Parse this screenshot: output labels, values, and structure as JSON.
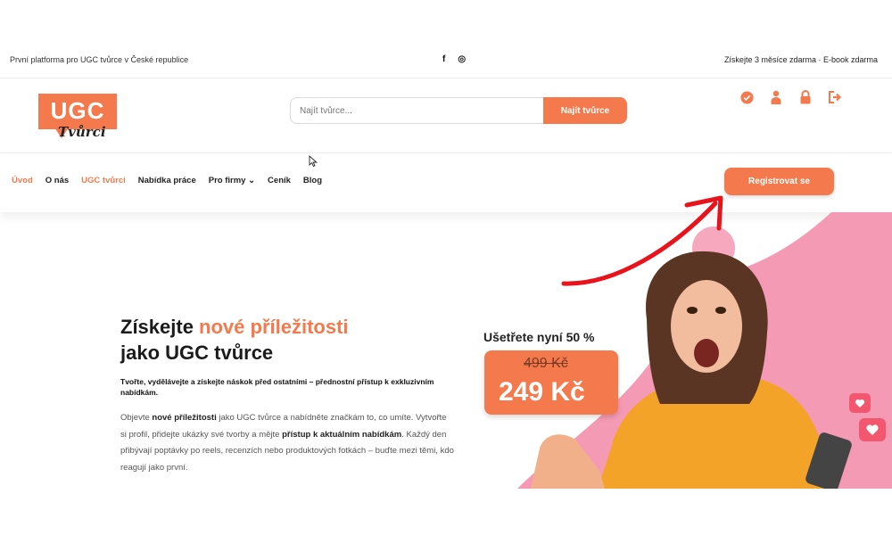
{
  "topbar": {
    "tagline": "První platforma pro UGC tvůrce v České republice",
    "social_facebook": "f",
    "social_instagram": "◎",
    "promo": "Získejte 3 měsíce zdarma · E-book zdarma"
  },
  "logo": {
    "line1": "UGC",
    "line2": "Tvůrci"
  },
  "search": {
    "placeholder": "Najít tvůrce...",
    "button": "Najít tvůrce"
  },
  "header_icons": [
    "check-circle-icon",
    "user-icon",
    "lock-icon",
    "logout-icon"
  ],
  "nav": {
    "items": [
      {
        "label": "Úvod",
        "active": true
      },
      {
        "label": "O nás"
      },
      {
        "label": "UGC tvůrci",
        "active": true
      },
      {
        "label": "Nabídka práce"
      },
      {
        "label": "Pro firmy ⌄"
      },
      {
        "label": "Ceník"
      },
      {
        "label": "Blog"
      }
    ],
    "register": "Registrovat se"
  },
  "hero": {
    "title_part1": "Získejte ",
    "title_accent": "nové příležitosti",
    "title_line2": "jako UGC tvůrce",
    "subtitle": "Tvořte, vydělávejte a získejte náskok před ostatními – přednostní přístup k exkluzivním nabídkám.",
    "body_1": "Objevte ",
    "body_2": "nové příležitosti",
    "body_3": " jako UGC tvůrce a nabídněte značkám to, co umíte. Vytvořte si profil, přidejte ukázky své tvorby a mějte ",
    "body_4": "přístup k aktuálním nabídkám",
    "body_5": ". Každý den přibývají poptávky po reels, recenzích nebo produktových fotkách – buďte mezi těmi, kdo reagují jako první."
  },
  "pricing": {
    "savings": "Ušetřete nyní 50 %",
    "old_price": "499 Kč",
    "new_price": "249 Kč"
  },
  "colors": {
    "accent": "#f47a4e",
    "pink": "#f48aa7",
    "arrow": "#e8131b"
  }
}
